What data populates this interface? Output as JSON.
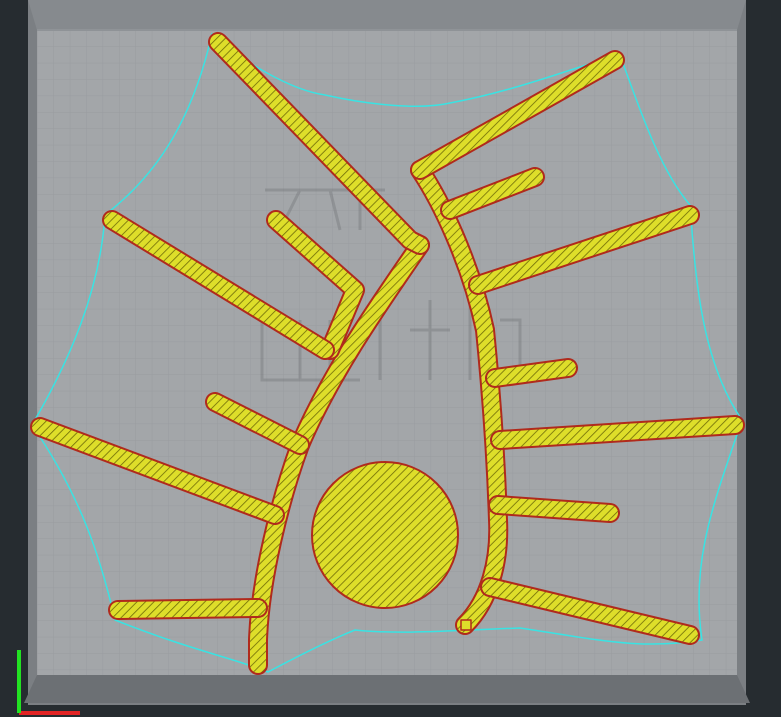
{
  "app": {
    "view": "layer-preview"
  },
  "colors": {
    "background": "#262c30",
    "bed_outer": "#7b7f83",
    "bed_inner": "#a3a6a9",
    "grid_minor": "#999ca0",
    "grid_major": "#8c9094",
    "extrusion_fill": "#dede2a",
    "extrusion_hatch": "#6e6b08",
    "perimeter_outline": "#b02a1c",
    "skirt": "#39e3e3",
    "axis_x": "#e22424",
    "axis_y": "#22e222"
  },
  "icons": {
    "axis_gizmo": "xy-axis-gizmo-icon"
  }
}
